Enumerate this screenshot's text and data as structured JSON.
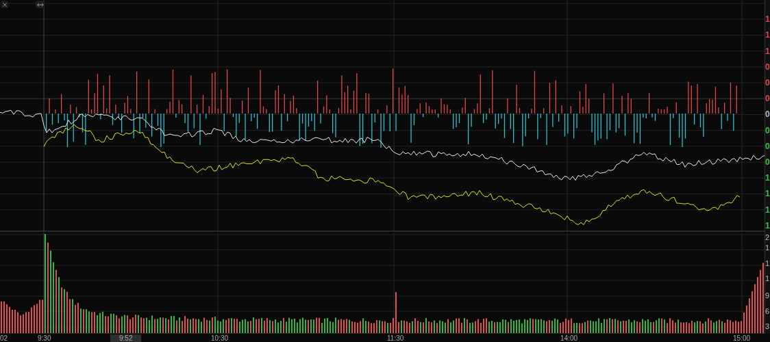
{
  "price_axis": {
    "labels": [
      {
        "text": "1",
        "color": "#e04848"
      },
      {
        "text": "1",
        "color": "#e04848"
      },
      {
        "text": "1",
        "color": "#e04848"
      },
      {
        "text": "0",
        "color": "#e04848"
      },
      {
        "text": "0",
        "color": "#e04848"
      },
      {
        "text": "0",
        "color": "#e04848"
      },
      {
        "text": "0",
        "color": "#a8b8d0"
      },
      {
        "text": "0",
        "color": "#3cc048"
      },
      {
        "text": "0",
        "color": "#3cc048"
      },
      {
        "text": "0",
        "color": "#3cc048"
      },
      {
        "text": "1",
        "color": "#3cc048"
      },
      {
        "text": "1",
        "color": "#3cc048"
      },
      {
        "text": "1",
        "color": "#3cc048"
      },
      {
        "text": "1",
        "color": "#3cc048"
      }
    ]
  },
  "volume_axis": {
    "labels": [
      "2",
      "1",
      "1",
      "1",
      "9",
      "6",
      "3"
    ]
  },
  "time_axis": {
    "labels": [
      {
        "text": "02",
        "selected": false
      },
      {
        "text": "9:30",
        "selected": false
      },
      {
        "text": "9:52",
        "selected": true
      },
      {
        "text": "10:30",
        "selected": false
      },
      {
        "text": "11:30",
        "selected": false
      },
      {
        "text": "14:00",
        "selected": false
      },
      {
        "text": "15:00",
        "selected": false
      }
    ]
  }
}
